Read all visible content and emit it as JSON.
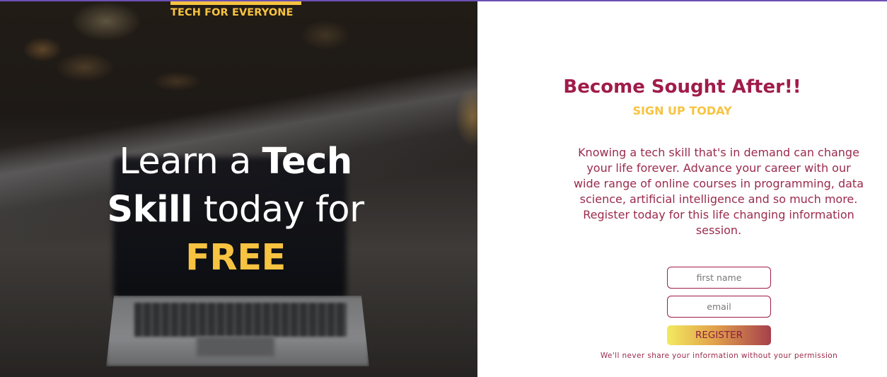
{
  "brand": {
    "name": "TECH FOR EVERYONE"
  },
  "hero": {
    "line1_thin": "Learn a ",
    "line1_bold": "Tech",
    "line2_bold": "Skill",
    "line2_thin": " today for",
    "line3_accent": "FREE"
  },
  "signup": {
    "title": "Become Sought After!!",
    "subtitle": "SIGN UP TODAY",
    "description": "Knowing a tech skill that's in demand can change your life forever. Advance your career with our wide range of online courses in programming, data science, artificial intelligence and so much more. Register today for this life changing information session.",
    "first_name_placeholder": "first name",
    "email_placeholder": "email",
    "register_label": "REGISTER",
    "privacy_note": "We'll never share your information without your permission"
  },
  "colors": {
    "accent_yellow": "#f7c340",
    "brand_maroon": "#a01c4a",
    "top_line": "#6c4fb5"
  }
}
